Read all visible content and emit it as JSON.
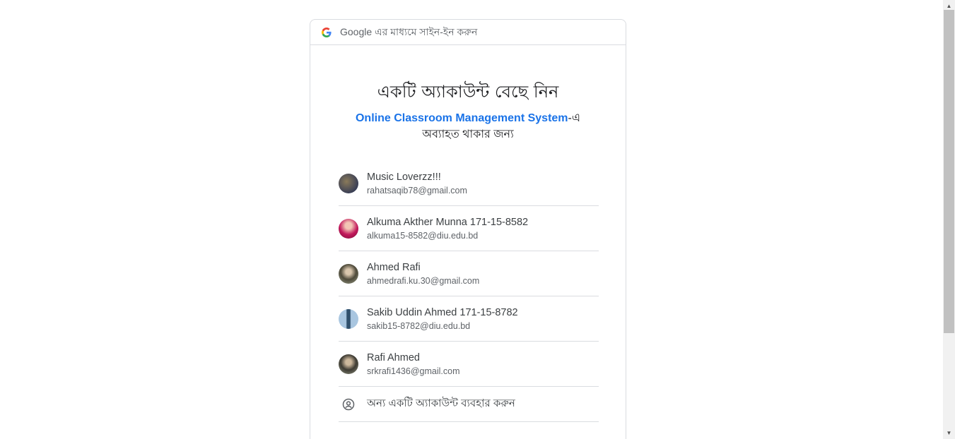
{
  "header": {
    "label": "Google এর মাধ্যমে সাইন-ইন করুন",
    "logo_icon": "google-g-icon"
  },
  "title": "একটি অ্যাকাউন্ট বেছে নিন",
  "subtitle": {
    "app_name": "Online Classroom Management System",
    "suffix": "-এ",
    "line2": "অব্যাহত থাকার জন্য"
  },
  "accounts": [
    {
      "name": "Music Loverzz!!!",
      "email": "rahatsaqib78@gmail.com",
      "avatar_color": "#3a3f55"
    },
    {
      "name": "Alkuma Akther Munna 171-15-8582",
      "email": "alkuma15-8582@diu.edu.bd",
      "avatar_color": "#c2185b"
    },
    {
      "name": "Ahmed Rafi",
      "email": "ahmedrafi.ku.30@gmail.com",
      "avatar_color": "#4e4a3a"
    },
    {
      "name": "Sakib Uddin Ahmed 171-15-8782",
      "email": "sakib15-8782@diu.edu.bd",
      "avatar_color": "#7fa6c9"
    },
    {
      "name": "Rafi Ahmed",
      "email": "srkrafi1436@gmail.com",
      "avatar_color": "#3e3b33"
    }
  ],
  "other_account": {
    "label": "অন্য একটি অ্যাকাউন্ট ব্যবহার করুন",
    "icon": "account-circle-icon"
  },
  "colors": {
    "link": "#1a73e8",
    "border": "#dadce0"
  }
}
